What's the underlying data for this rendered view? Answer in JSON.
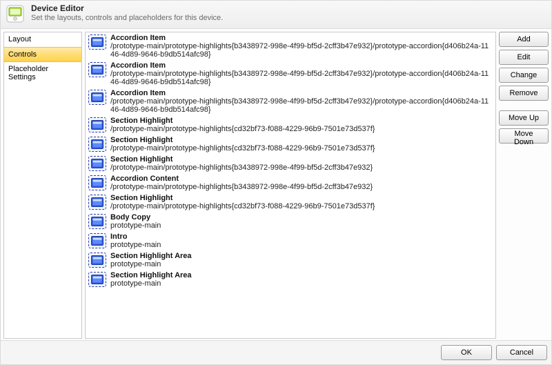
{
  "header": {
    "title": "Device Editor",
    "subtitle": "Set the layouts, controls and placeholders for this device."
  },
  "sidebar": {
    "items": [
      {
        "label": "Layout",
        "selected": false
      },
      {
        "label": "Controls",
        "selected": true
      },
      {
        "label": "Placeholder Settings",
        "selected": false
      }
    ]
  },
  "controls": [
    {
      "title": "Accordion Item",
      "path": "/prototype-main/prototype-highlights{b3438972-998e-4f99-bf5d-2cff3b47e932}/prototype-accordion{d406b24a-1146-4d89-9646-b9db514afc98}"
    },
    {
      "title": "Accordion Item",
      "path": "/prototype-main/prototype-highlights{b3438972-998e-4f99-bf5d-2cff3b47e932}/prototype-accordion{d406b24a-1146-4d89-9646-b9db514afc98}"
    },
    {
      "title": "Accordion Item",
      "path": "/prototype-main/prototype-highlights{b3438972-998e-4f99-bf5d-2cff3b47e932}/prototype-accordion{d406b24a-1146-4d89-9646-b9db514afc98}"
    },
    {
      "title": "Section Highlight",
      "path": "/prototype-main/prototype-highlights{cd32bf73-f088-4229-96b9-7501e73d537f}"
    },
    {
      "title": "Section Highlight",
      "path": "/prototype-main/prototype-highlights{cd32bf73-f088-4229-96b9-7501e73d537f}"
    },
    {
      "title": "Section Highlight",
      "path": "/prototype-main/prototype-highlights{b3438972-998e-4f99-bf5d-2cff3b47e932}"
    },
    {
      "title": "Accordion Content",
      "path": "/prototype-main/prototype-highlights{b3438972-998e-4f99-bf5d-2cff3b47e932}"
    },
    {
      "title": "Section Highlight",
      "path": "/prototype-main/prototype-highlights{cd32bf73-f088-4229-96b9-7501e73d537f}"
    },
    {
      "title": "Body Copy",
      "path": "prototype-main"
    },
    {
      "title": "Intro",
      "path": "prototype-main"
    },
    {
      "title": "Section Highlight Area",
      "path": "prototype-main"
    },
    {
      "title": "Section Highlight Area",
      "path": "prototype-main"
    }
  ],
  "buttons": {
    "add": "Add",
    "edit": "Edit",
    "change": "Change",
    "remove": "Remove",
    "moveUp": "Move Up",
    "moveDown": "Move Down"
  },
  "footer": {
    "ok": "OK",
    "cancel": "Cancel"
  },
  "icons": {
    "header": "device-icon",
    "row": "layout-placeholder-icon"
  }
}
